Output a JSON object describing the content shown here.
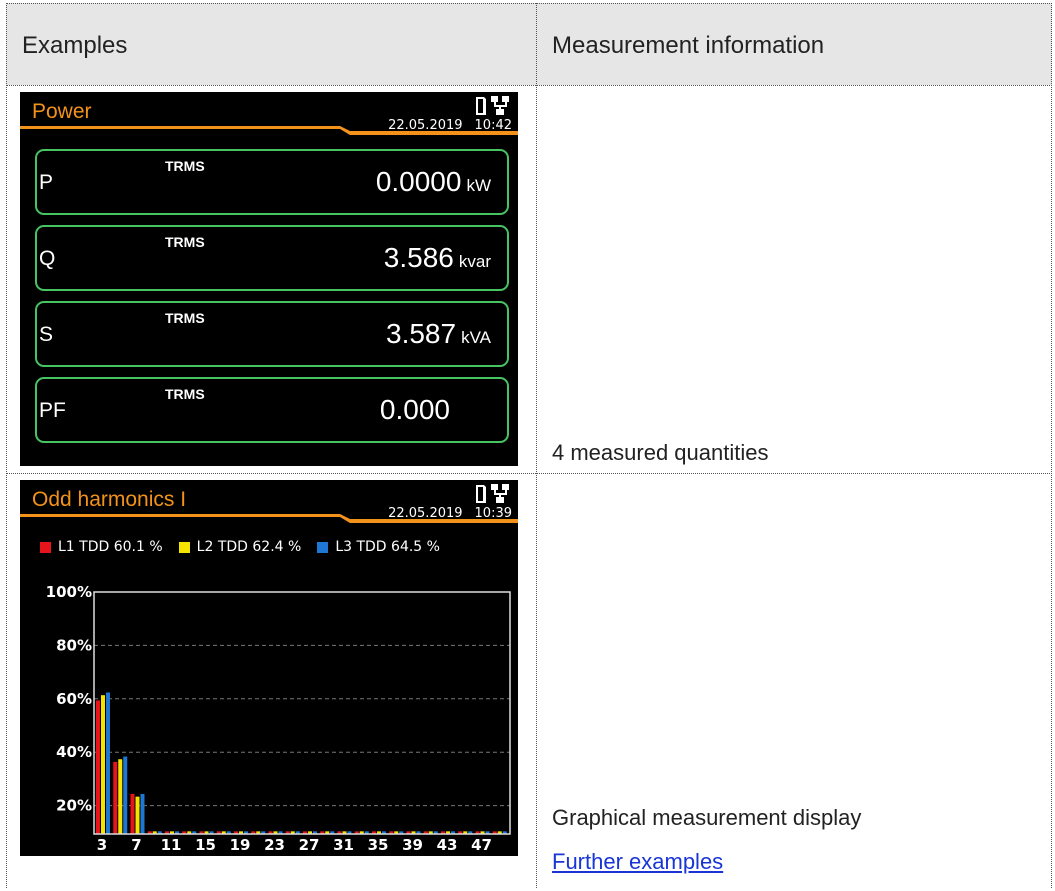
{
  "table": {
    "col_examples": "Examples",
    "col_info": "Measurement information",
    "row1_info": "4 measured quantities",
    "row2_info": "Graphical measurement display",
    "further_link": "Further examples"
  },
  "power_screen": {
    "title": "Power",
    "date": "22.05.2019",
    "time": "10:42",
    "title_color": "#f3921a",
    "box_border_color": "#46c463",
    "status_icons": [
      "memory-card-icon",
      "network-icon"
    ],
    "quantities": [
      {
        "label": "P",
        "mode": "TRMS",
        "value": "0.0000",
        "unit": "kW"
      },
      {
        "label": "Q",
        "mode": "TRMS",
        "value": "3.586",
        "unit": "kvar"
      },
      {
        "label": "S",
        "mode": "TRMS",
        "value": "3.587",
        "unit": "kVA"
      },
      {
        "label": "PF",
        "mode": "TRMS",
        "value": "0.000",
        "unit": ""
      }
    ]
  },
  "harmonics_screen": {
    "title": "Odd harmonics I",
    "date": "22.05.2019",
    "time": "10:39",
    "status_icons": [
      "memory-card-icon",
      "network-icon"
    ],
    "legend": [
      {
        "label": "L1 TDD 60.1 %",
        "color": "#e8141c"
      },
      {
        "label": "L2 TDD 62.4 %",
        "color": "#f4e400"
      },
      {
        "label": "L3 TDD 64.5 %",
        "color": "#1e77d3"
      }
    ]
  },
  "chart_data": {
    "type": "bar",
    "categories": [
      "3",
      "5",
      "7",
      "9",
      "11",
      "13",
      "15",
      "17",
      "19",
      "21",
      "23",
      "25",
      "27",
      "29",
      "31",
      "33",
      "35",
      "37",
      "39",
      "41",
      "43",
      "45",
      "47",
      "49"
    ],
    "x_tick_labels": [
      "3",
      "7",
      "11",
      "15",
      "19",
      "23",
      "27",
      "31",
      "35",
      "39",
      "43",
      "47"
    ],
    "y_tick_labels": [
      "100%",
      "80%",
      "60%",
      "40%",
      "20%"
    ],
    "ylim": [
      0,
      100
    ],
    "grid": "dashed horizontal",
    "series": [
      {
        "name": "L1",
        "color": "#e8141c",
        "values": [
          50,
          27,
          15,
          1,
          1,
          1,
          1,
          1,
          1,
          1,
          1,
          1,
          1,
          1,
          1,
          1,
          1,
          1,
          1,
          1,
          1,
          1,
          1,
          1
        ]
      },
      {
        "name": "L2",
        "color": "#f4e400",
        "values": [
          52,
          28,
          14,
          1,
          1,
          1,
          1,
          1,
          1,
          1,
          1,
          1,
          1,
          1,
          1,
          1,
          1,
          1,
          1,
          1,
          1,
          1,
          1,
          1
        ]
      },
      {
        "name": "L3",
        "color": "#1e77d3",
        "values": [
          53,
          29,
          15,
          1,
          1,
          1,
          1,
          1,
          1,
          1,
          1,
          1,
          1,
          1,
          1,
          1,
          1,
          1,
          1,
          1,
          1,
          1,
          1,
          1
        ]
      }
    ]
  }
}
